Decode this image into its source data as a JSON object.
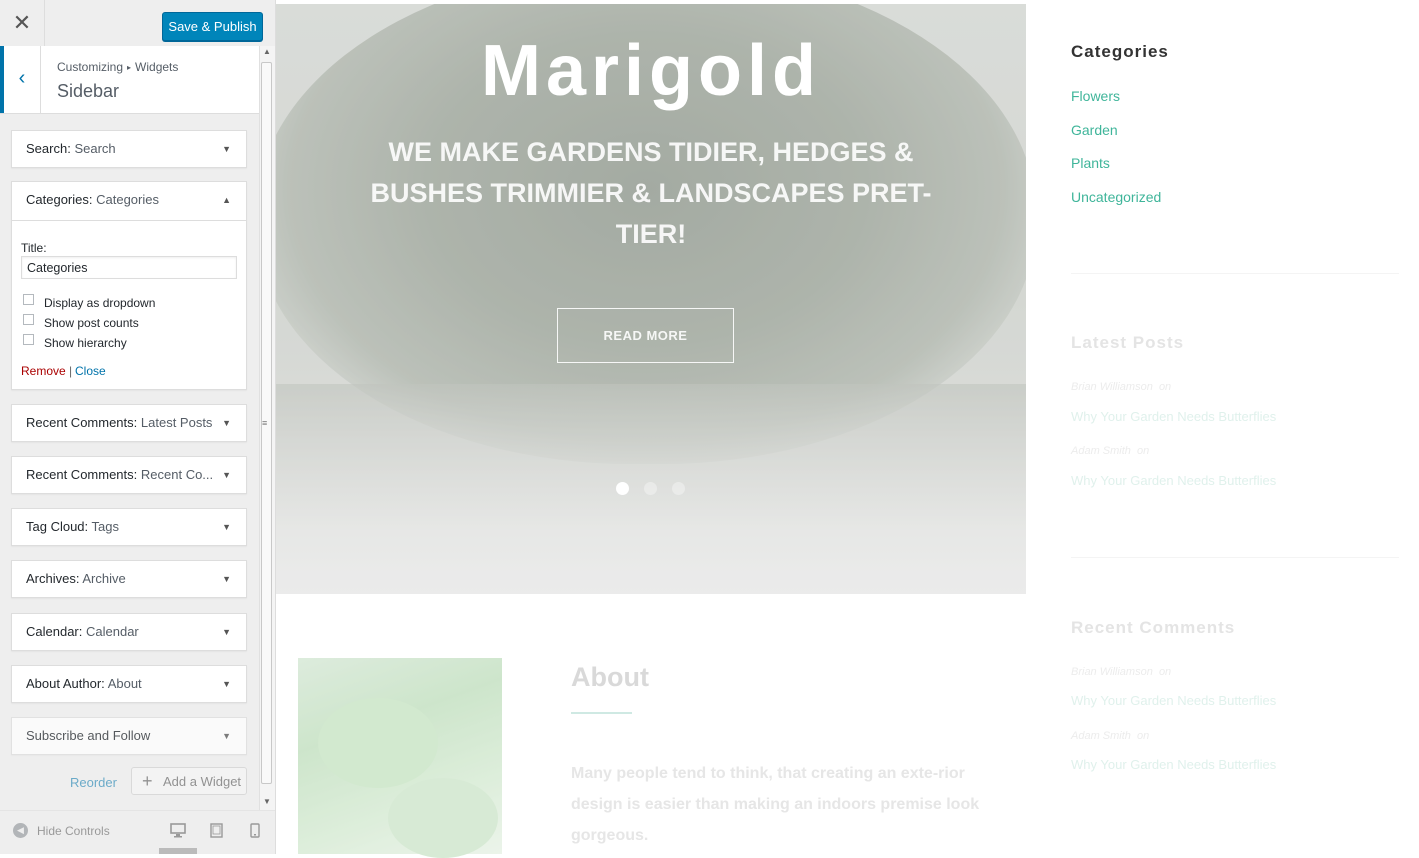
{
  "customizer": {
    "close_icon": "✕",
    "publish_label": "Save & Publish",
    "breadcrumb": {
      "parent": "Customizing",
      "separator": "▸",
      "current": "Widgets"
    },
    "panel_title": "Sidebar",
    "back_icon": "‹"
  },
  "widgets": [
    {
      "type": "Search:",
      "name": "Search",
      "arrow": "▼"
    },
    {
      "type": "Categories:",
      "name": "Categories",
      "arrow": "▲"
    },
    {
      "type": "Recent Comments:",
      "name": "Latest Posts",
      "arrow": "▼"
    },
    {
      "type": "Recent Comments:",
      "name": "Recent Co...",
      "arrow": "▼"
    },
    {
      "type": "Tag Cloud:",
      "name": "Tags",
      "arrow": "▼"
    },
    {
      "type": "Archives:",
      "name": "Archive",
      "arrow": "▼"
    },
    {
      "type": "Calendar:",
      "name": "Calendar",
      "arrow": "▼"
    },
    {
      "type": "About Author:",
      "name": "About",
      "arrow": "▼"
    },
    {
      "type": "Subscribe and Follow",
      "name": "",
      "arrow": "▼"
    }
  ],
  "categories_form": {
    "title_label": "Title:",
    "title_value": "Categories",
    "options": [
      {
        "label": "Display as dropdown",
        "checked": false
      },
      {
        "label": "Show post counts",
        "checked": false
      },
      {
        "label": "Show hierarchy",
        "checked": false
      }
    ],
    "remove_label": "Remove",
    "separator": "|",
    "close_label": "Close"
  },
  "panel_actions": {
    "reorder_label": "Reorder",
    "add_widget_label": "Add a Widget",
    "add_icon": "+"
  },
  "footer": {
    "hide_icon": "◀",
    "hide_label": "Hide Controls",
    "devices": [
      "desktop-icon",
      "tablet-icon",
      "mobile-icon"
    ]
  },
  "preview": {
    "site_title": "Marigold",
    "tagline": "WE MAKE GARDENS TIDIER, HEDGES & BUSHES TRIMMIER & LANDSCAPES PRET-TIER!",
    "read_more": "READ MORE",
    "slider_dots": 3,
    "about": {
      "title": "About",
      "text": "Many people tend to think, that creating an exte-rior design is easier than making an indoors premise look gorgeous."
    },
    "sidebar": {
      "categories_title": "Categories",
      "categories": [
        "Flowers",
        "Garden",
        "Plants",
        "Uncategorized"
      ],
      "latest_posts_title": "Latest Posts",
      "latest_posts": [
        {
          "author": "Brian Williamson",
          "on": "on",
          "post": "Why Your Garden Needs Butterflies"
        },
        {
          "author": "Adam Smith",
          "on": "on",
          "post": "Why Your Garden Needs Butterflies"
        }
      ],
      "recent_comments_title": "Recent Comments",
      "recent_comments": [
        {
          "author": "Brian Williamson",
          "on": "on",
          "post": "Why Your Garden Needs Butterflies"
        },
        {
          "author": "Adam Smith",
          "on": "on",
          "post": "Why Your Garden Needs Butterflies"
        }
      ]
    }
  },
  "colors": {
    "accent": "#0085ba",
    "link": "#0073aa",
    "remove": "#aa0000",
    "category_link": "#3fb59a"
  }
}
